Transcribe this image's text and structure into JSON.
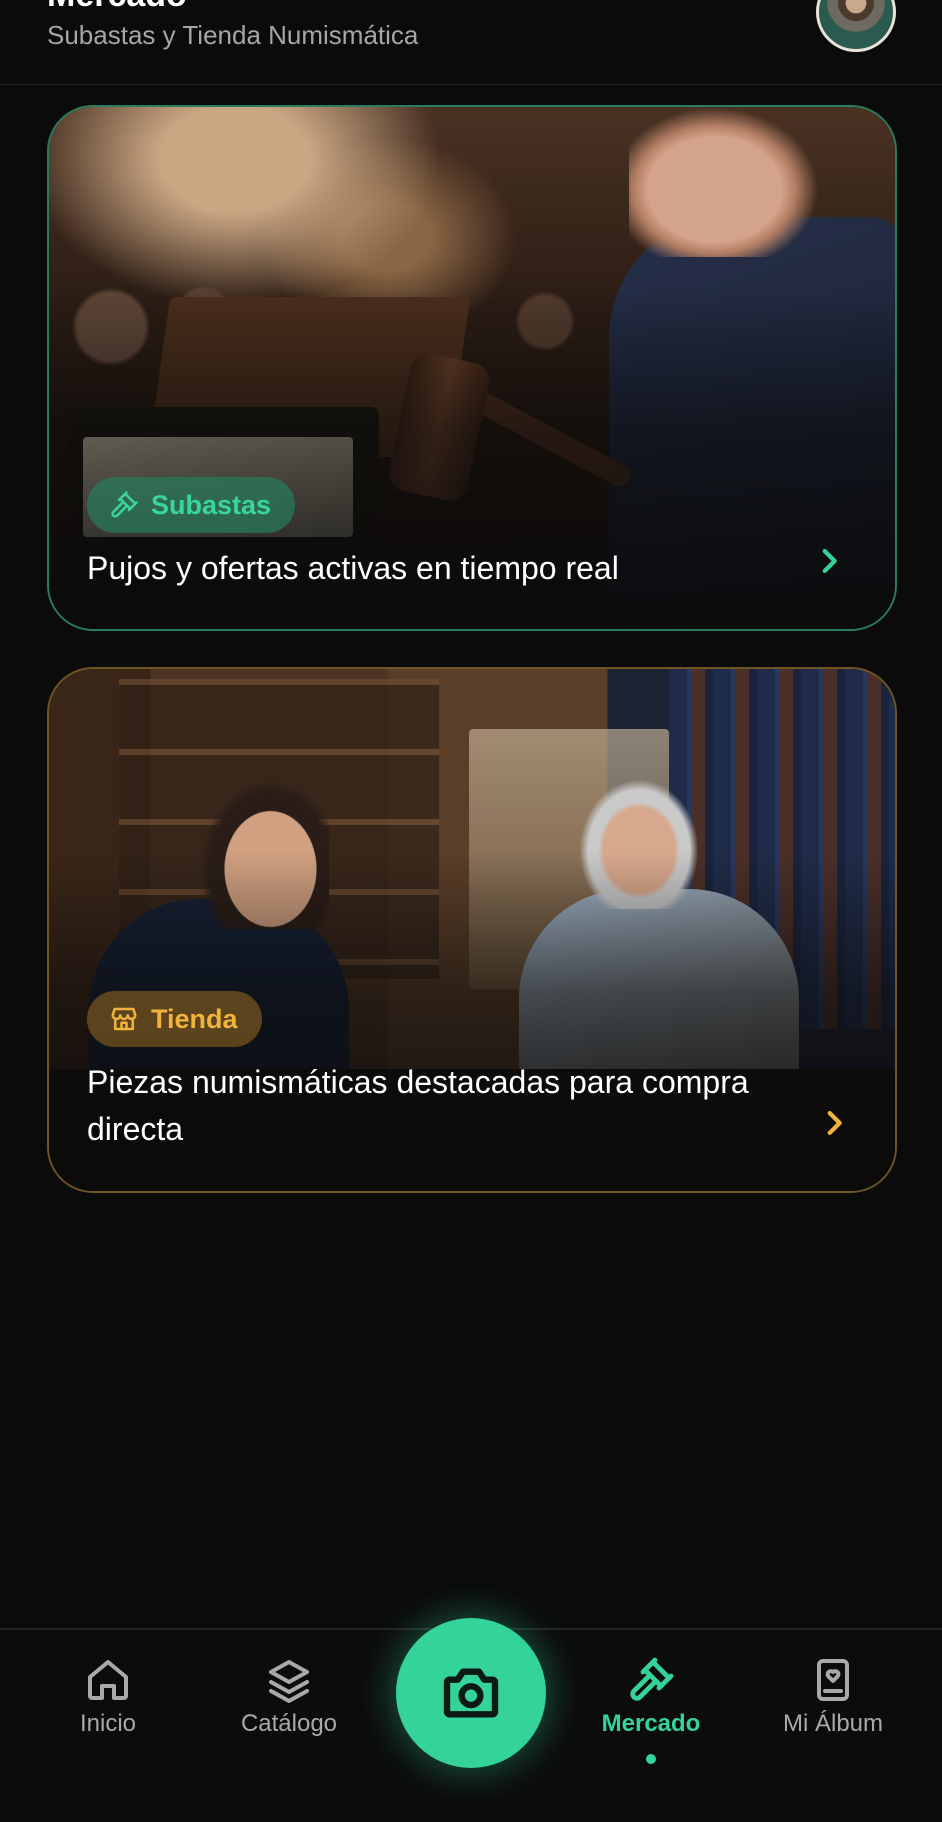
{
  "header": {
    "title": "Mercado",
    "subtitle": "Subastas y Tienda Numismática"
  },
  "cards": [
    {
      "badge": "Subastas",
      "badge_icon": "gavel-icon",
      "text": "Pujos y ofertas activas en tiempo real",
      "accent": "#34d399"
    },
    {
      "badge": "Tienda",
      "badge_icon": "store-icon",
      "text": "Piezas numismáticas destacadas para compra directa",
      "accent": "#f2b33c"
    }
  ],
  "nav": {
    "items": [
      {
        "label": "Inicio",
        "icon": "home-icon"
      },
      {
        "label": "Catálogo",
        "icon": "layers-icon"
      },
      {
        "label": "Mercado",
        "icon": "gavel-icon",
        "active": true
      },
      {
        "label": "Mi Álbum",
        "icon": "album-icon"
      }
    ],
    "center_icon": "camera-icon"
  },
  "colors": {
    "background": "#0b0b0b",
    "accent_green": "#34d399",
    "accent_gold": "#f2b33c",
    "text_muted": "#a6a6a6"
  }
}
